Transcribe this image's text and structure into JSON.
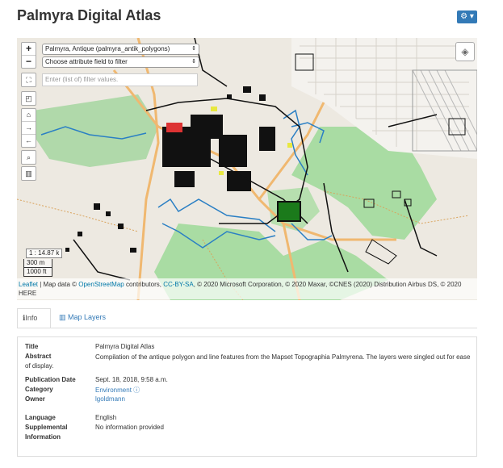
{
  "page": {
    "title": "Palmyra Digital Atlas",
    "gear_icon": "gear-icon",
    "accent": "#337ab7"
  },
  "map": {
    "zoom_in": "+",
    "zoom_out": "−",
    "layer_select": "Palmyra, Antique (palmyra_antik_polygons)",
    "attribute_select": "Choose attribute field to filter",
    "filter_placeholder": "Enter (list of) filter values.",
    "scale_fraction": "1 : 14.87 k",
    "scale_metric": "300 m",
    "scale_imperial": "1000 ft",
    "attribution": {
      "leaflet": "Leaflet",
      "map_data": " | Map data © ",
      "osm": "OpenStreetMap",
      "contributors": " contributors, ",
      "license": "CC-BY-SA",
      "rest": ", © 2020 Microsoft Corporation, © 2020 Maxar, ©CNES (2020) Distribution Airbus DS, © 2020 HERE"
    }
  },
  "tabs": {
    "info": "Info",
    "map_layers": "Map Layers"
  },
  "info": {
    "title_label": "Title",
    "title_value": "Palmyra Digital Atlas",
    "abstract_label": "Abstract",
    "abstract_value": "Compilation of the antique polygon and line features from the Mapset Topographia Palmyrena. The layers were singled out for ease of display.",
    "publication_label": "Publication Date",
    "publication_value": "Sept. 18, 2018, 9:58 a.m.",
    "category_label": "Category",
    "category_value": "Environment",
    "owner_label": "Owner",
    "owner_value": "lgoldmann",
    "language_label": "Language",
    "language_value": "English",
    "supplemental_label_1": "Supplemental",
    "supplemental_label_2": "Information",
    "supplemental_value": "No information provided"
  }
}
